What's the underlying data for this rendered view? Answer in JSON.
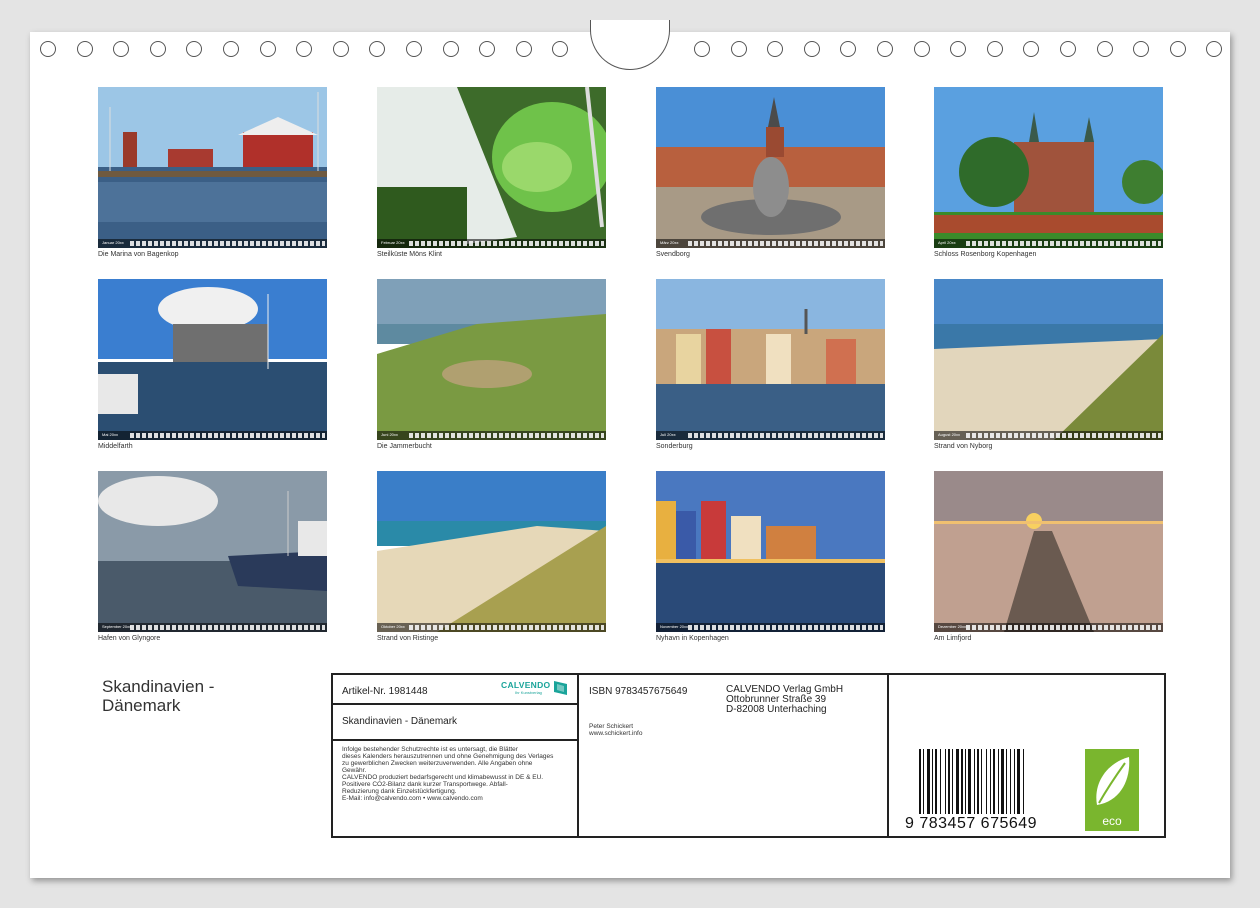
{
  "photos": [
    {
      "caption": "Die Marina von Bagenkop",
      "month": "Januar 20xx"
    },
    {
      "caption": "Steilküste Möns Klint",
      "month": "Februar 20xx"
    },
    {
      "caption": "Svendborg",
      "month": "März 20xx"
    },
    {
      "caption": "Schloss Rosenborg Kopenhagen",
      "month": "April 20xx"
    },
    {
      "caption": "Middelfarth",
      "month": "Mai 20xx"
    },
    {
      "caption": "Die Jammerbucht",
      "month": "Juni 20xx"
    },
    {
      "caption": "Sonderburg",
      "month": "Juli 20xx"
    },
    {
      "caption": "Strand von Nyborg",
      "month": "August 20xx"
    },
    {
      "caption": "Hafen von Glyngore",
      "month": "September 20xx"
    },
    {
      "caption": "Strand von Ristinge",
      "month": "Oktober 20xx"
    },
    {
      "caption": "Nyhavn in Kopenhagen",
      "month": "November 20xx"
    },
    {
      "caption": "Am Limfjord",
      "month": "Dezember 20xx"
    }
  ],
  "title": {
    "line1": "Skandinavien -",
    "line2": "Dänemark"
  },
  "info": {
    "article": "Artikel-Nr. 1981448",
    "brand": "CALVENDO",
    "brand_sub": "Ihr Kunstverlag",
    "product_title": "Skandinavien - Dänemark",
    "legal": [
      "Infolge bestehender Schutzrechte ist es untersagt, die Blätter",
      "dieses Kalenders herauszutrennen und ohne Genehmigung des Verlages",
      "zu gewerblichen Zwecken weiterzuverwenden. Alle Angaben ohne",
      "Gewähr.",
      "CALVENDO produziert bedarfsgerecht und klimabewusst in DE & EU.",
      "Positivere CO2-Bilanz dank kurzer Transportwege. Abfall-",
      "Reduzierung dank Einzelstückfertigung.",
      "E-Mail: info@calvendo.com • www.calvendo.com"
    ],
    "isbn": "ISBN 9783457675649",
    "publisher": [
      "CALVENDO Verlag GmbH",
      "Ottobrunner Straße 39",
      "D-82008 Unterhaching"
    ],
    "author": "Peter Schickert",
    "author_url": "www.schickert.info",
    "ean": "9 783457 675649",
    "eco_label": "eco"
  }
}
